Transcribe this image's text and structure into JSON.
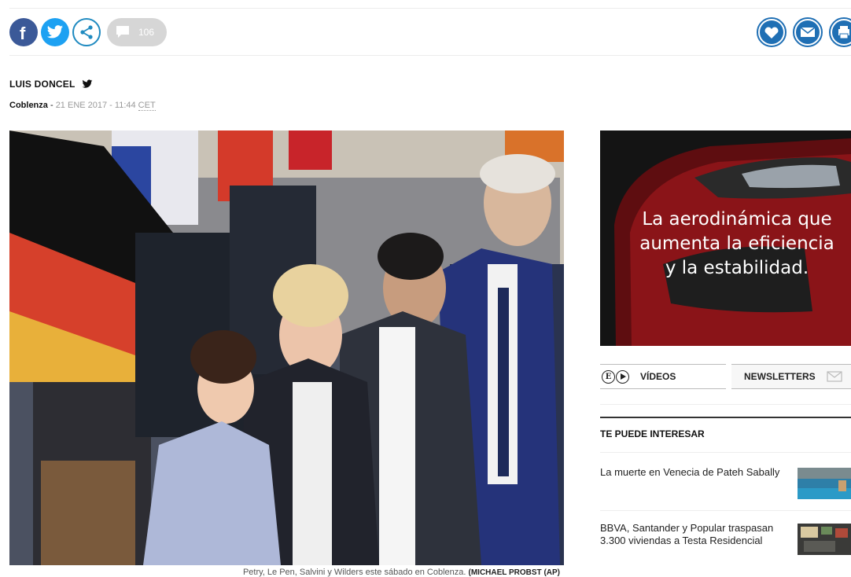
{
  "share": {
    "comment_count": "106",
    "icons": [
      "facebook-icon",
      "twitter-icon",
      "share-icon",
      "comment-icon",
      "favorite-icon",
      "email-icon",
      "print-icon"
    ]
  },
  "byline": {
    "author": "LUIS DONCEL",
    "city": "Coblenza",
    "separator": " - ",
    "date": "21 ENE 2017 - 11:44 ",
    "timezone": "CET"
  },
  "photo": {
    "caption": "Petry, Le Pen, Salvini y Wilders este sábado en Coblenza.",
    "credit": "(MICHAEL PROBST (AP)"
  },
  "ad": {
    "lines": [
      "La aerodinámica que",
      "aumenta la eficiencia",
      "y la estabilidad."
    ]
  },
  "tabs": {
    "videos": "VÍDEOS",
    "newsletters": "NEWSLETTERS"
  },
  "interest": {
    "title": "TE PUEDE INTERESAR",
    "items": [
      {
        "title": "La muerte en Venecia de Pateh Sabally"
      },
      {
        "title": "BBVA, Santander y Popular traspasan 3.300 viviendas a Testa Residencial"
      }
    ]
  },
  "colors": {
    "facebook": "#3b5998",
    "twitter": "#1da1f2",
    "accent_blue": "#1f6fb4"
  }
}
